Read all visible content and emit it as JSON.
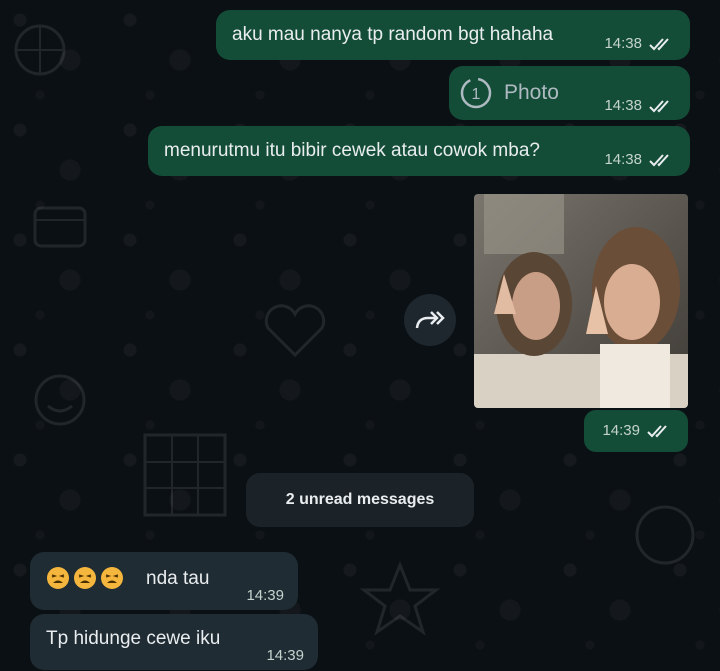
{
  "messages": [
    {
      "id": "m1",
      "direction": "outgoing",
      "text": "aku mau nanya tp random bgt hahaha",
      "time": "14:38",
      "status": "read"
    },
    {
      "id": "m2",
      "direction": "outgoing",
      "type": "view-once-photo",
      "label": "Photo",
      "once_icon_text": "1",
      "time": "14:38",
      "status": "read"
    },
    {
      "id": "m3",
      "direction": "outgoing",
      "text": "menurutmu itu bibir cewek atau cowok mba?",
      "time": "14:38",
      "status": "read"
    },
    {
      "id": "m4",
      "direction": "outgoing",
      "type": "image",
      "time": "14:39",
      "status": "read"
    },
    {
      "id": "m5",
      "direction": "incoming",
      "emoji": [
        "tired-face",
        "tired-face",
        "tired-face"
      ],
      "text": "nda tau",
      "time": "14:39"
    },
    {
      "id": "m6",
      "direction": "incoming",
      "text": "Tp hidunge cewe iku",
      "time": "14:39"
    }
  ],
  "unread_banner": "2 unread messages",
  "icons": {
    "read_ticks": "double-check-icon",
    "forward": "forward-icon",
    "view_once": "view-once-icon",
    "emoji": "tired-face-icon"
  },
  "colors": {
    "background": "#0b1014",
    "outgoing_bubble": "#144d37",
    "incoming_bubble": "#1f2c33",
    "read_ticks": "#e9edef"
  }
}
